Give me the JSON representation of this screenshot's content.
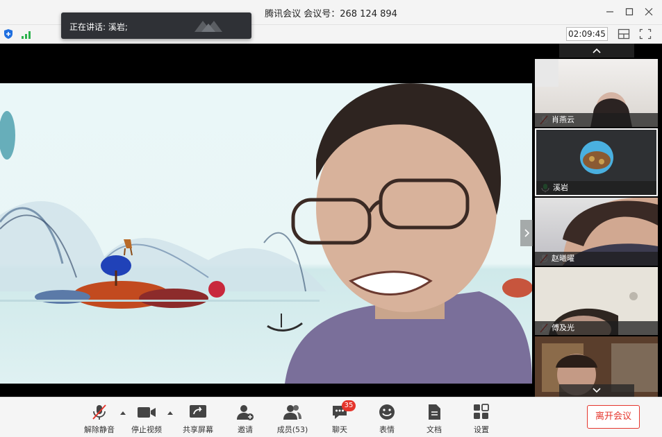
{
  "window": {
    "title": "腾讯会议 会议号：268 124 894"
  },
  "status": {
    "elapsed": "02:09:45"
  },
  "toast": {
    "text": "正在讲话: 溪岩;"
  },
  "participants": [
    {
      "name": "肖燕云",
      "muted": true
    },
    {
      "name": "溪岩",
      "muted": false,
      "active": true
    },
    {
      "name": "赵曦曜",
      "muted": true
    },
    {
      "name": "傅及光",
      "muted": true
    },
    {
      "name": "",
      "muted": true
    }
  ],
  "toolbar": {
    "mute": "解除静音",
    "video": "停止视频",
    "share": "共享屏幕",
    "invite": "邀请",
    "members": "成员(53)",
    "chat": "聊天",
    "chat_badge": "35",
    "emoji": "表情",
    "docs": "文档",
    "settings": "设置",
    "leave": "离开会议"
  },
  "colors": {
    "accent_red": "#e5352c",
    "toolbar_bg": "#f5f5f5"
  }
}
